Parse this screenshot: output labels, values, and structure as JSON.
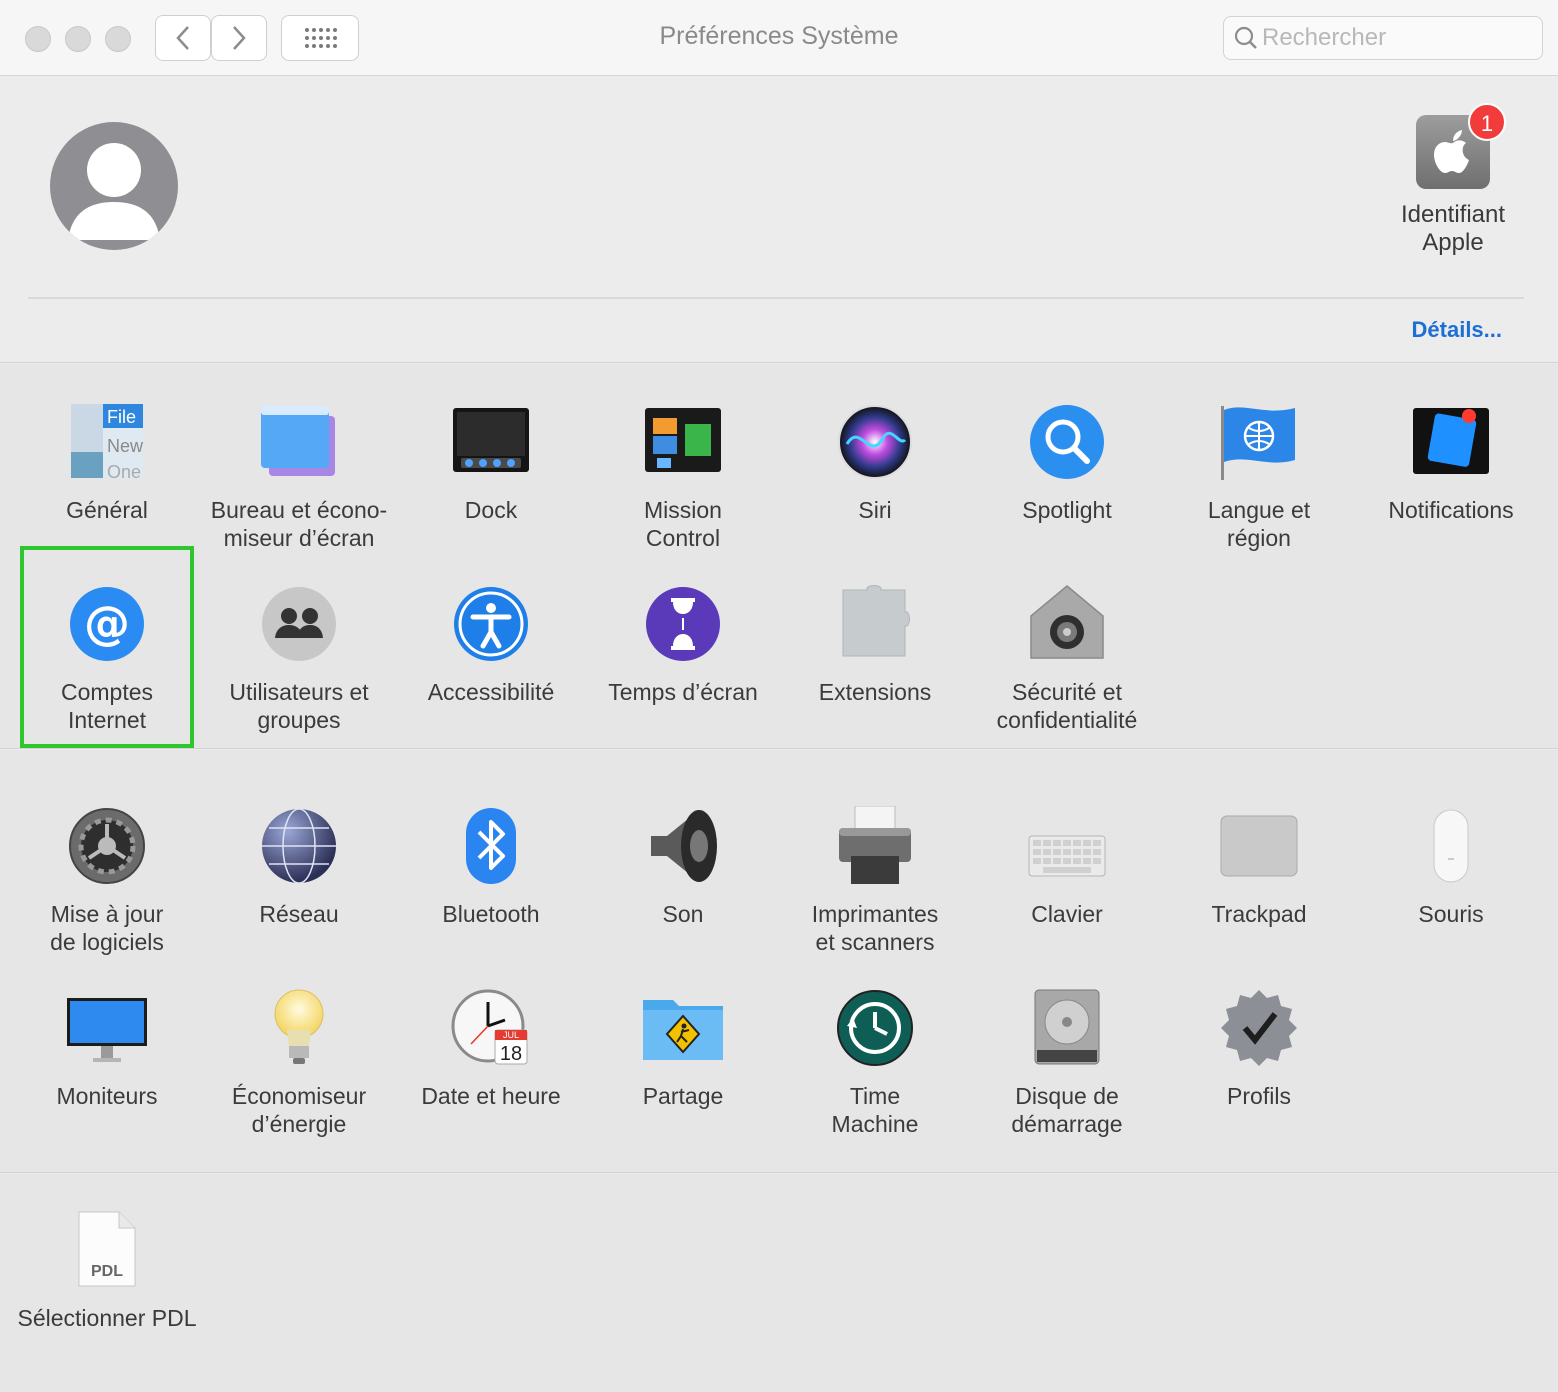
{
  "window": {
    "title": "Préférences Système",
    "search_placeholder": "Rechercher"
  },
  "header": {
    "apple_id": {
      "label_line1": "Identifiant",
      "label_line2": "Apple",
      "badge": "1"
    },
    "details_link": "Détails..."
  },
  "section1": [
    {
      "line1": "Général",
      "line2": "",
      "icon": "general-icon"
    },
    {
      "line1": "Bureau et écono-",
      "line2": "miseur d’écran",
      "icon": "desktop-screensaver-icon"
    },
    {
      "line1": "Dock",
      "line2": "",
      "icon": "dock-icon"
    },
    {
      "line1": "Mission",
      "line2": "Control",
      "icon": "mission-control-icon"
    },
    {
      "line1": "Siri",
      "line2": "",
      "icon": "siri-icon"
    },
    {
      "line1": "Spotlight",
      "line2": "",
      "icon": "spotlight-icon"
    },
    {
      "line1": "Langue et",
      "line2": "région",
      "icon": "language-region-icon"
    },
    {
      "line1": "Notifications",
      "line2": "",
      "icon": "notifications-icon"
    },
    {
      "line1": "Comptes",
      "line2": "Internet",
      "icon": "internet-accounts-icon"
    },
    {
      "line1": "Utilisateurs et",
      "line2": "groupes",
      "icon": "users-groups-icon"
    },
    {
      "line1": "Accessibilité",
      "line2": "",
      "icon": "accessibility-icon"
    },
    {
      "line1": "Temps d’écran",
      "line2": "",
      "icon": "screen-time-icon"
    },
    {
      "line1": "Extensions",
      "line2": "",
      "icon": "extensions-icon"
    },
    {
      "line1": "Sécurité et",
      "line2": "confidentialité",
      "icon": "security-privacy-icon"
    }
  ],
  "section2": [
    {
      "line1": "Mise à jour",
      "line2": "de logiciels",
      "icon": "software-update-icon"
    },
    {
      "line1": "Réseau",
      "line2": "",
      "icon": "network-icon"
    },
    {
      "line1": "Bluetooth",
      "line2": "",
      "icon": "bluetooth-icon"
    },
    {
      "line1": "Son",
      "line2": "",
      "icon": "sound-icon"
    },
    {
      "line1": "Imprimantes",
      "line2": "et scanners",
      "icon": "printers-scanners-icon"
    },
    {
      "line1": "Clavier",
      "line2": "",
      "icon": "keyboard-icon"
    },
    {
      "line1": "Trackpad",
      "line2": "",
      "icon": "trackpad-icon"
    },
    {
      "line1": "Souris",
      "line2": "",
      "icon": "mouse-icon"
    },
    {
      "line1": "Moniteurs",
      "line2": "",
      "icon": "displays-icon"
    },
    {
      "line1": "Économiseur",
      "line2": "d’énergie",
      "icon": "energy-saver-icon"
    },
    {
      "line1": "Date et heure",
      "line2": "",
      "icon": "date-time-icon"
    },
    {
      "line1": "Partage",
      "line2": "",
      "icon": "sharing-icon"
    },
    {
      "line1": "Time",
      "line2": "Machine",
      "icon": "time-machine-icon"
    },
    {
      "line1": "Disque de",
      "line2": "démarrage",
      "icon": "startup-disk-icon"
    },
    {
      "line1": "Profils",
      "line2": "",
      "icon": "profiles-icon"
    }
  ],
  "section3": [
    {
      "line1": "Sélectionner PDL",
      "line2": "",
      "icon": "pdl-file-icon"
    }
  ],
  "icon_text": {
    "general": {
      "file": "File",
      "new": "New",
      "open": "One"
    },
    "date": {
      "month": "JUL",
      "day": "18"
    },
    "pdl": "PDL"
  },
  "colors": {
    "highlight": "#2ec52e",
    "link": "#1d6fd6",
    "badge": "#f23b3b"
  }
}
